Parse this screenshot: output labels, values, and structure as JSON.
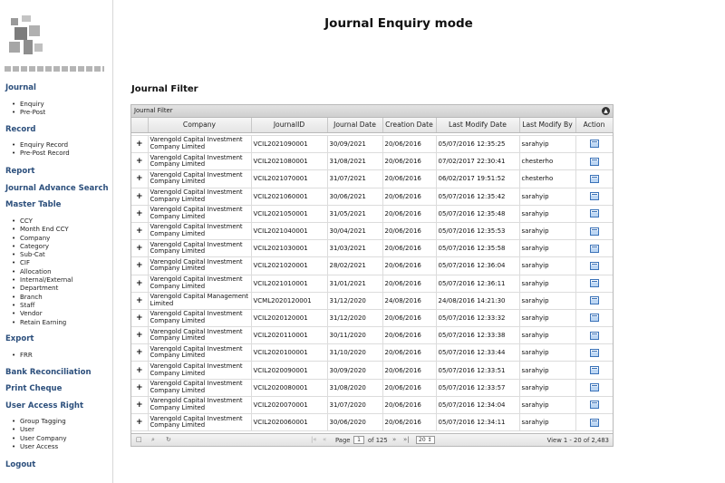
{
  "header": {
    "title": "Journal Enquiry mode"
  },
  "sidebar": {
    "journal": {
      "label": "Journal",
      "items": [
        "Enquiry",
        "Pre-Post"
      ]
    },
    "record": {
      "label": "Record",
      "items": [
        "Enquiry Record",
        "Pre-Post Record"
      ]
    },
    "report": {
      "label": "Report"
    },
    "journal_advance_search": {
      "label": "Journal Advance Search"
    },
    "master_table": {
      "label": "Master Table",
      "items": [
        "CCY",
        "Month End CCY",
        "Company",
        "Category",
        "Sub-Cat",
        "CIF",
        "Allocation",
        "Internal/External",
        "Department",
        "Branch",
        "Staff",
        "Vendor",
        "Retain Earning"
      ]
    },
    "export": {
      "label": "Export",
      "items": [
        "FRR"
      ]
    },
    "bank_reconciliation": {
      "label": "Bank Reconciliation"
    },
    "print_cheque": {
      "label": "Print Cheque"
    },
    "user_access_right": {
      "label": "User Access Right",
      "items": [
        "Group Tagging",
        "User",
        "User Company",
        "User Access"
      ]
    },
    "logout": {
      "label": "Logout"
    }
  },
  "main": {
    "section_heading": "Journal Filter",
    "grid": {
      "caption": "Journal Filter",
      "columns": [
        "Company",
        "JournalID",
        "Journal Date",
        "Creation Date",
        "Last Modify Date",
        "Last Modify By",
        "Action"
      ],
      "rows": [
        {
          "expand": "+",
          "company": "Varengold Capital Investment Company Limited",
          "journal_id": "VCIL2021090001",
          "journal_date": "30/09/2021",
          "creation_date": "20/06/2016",
          "last_modify_date": "05/07/2016 12:35:25",
          "last_modify_by": "sarahyip"
        },
        {
          "expand": "+",
          "company": "Varengold Capital Investment Company Limited",
          "journal_id": "VCIL2021080001",
          "journal_date": "31/08/2021",
          "creation_date": "20/06/2016",
          "last_modify_date": "07/02/2017 22:30:41",
          "last_modify_by": "chesterho"
        },
        {
          "expand": "+",
          "company": "Varengold Capital Investment Company Limited",
          "journal_id": "VCIL2021070001",
          "journal_date": "31/07/2021",
          "creation_date": "20/06/2016",
          "last_modify_date": "06/02/2017 19:51:52",
          "last_modify_by": "chesterho"
        },
        {
          "expand": "+",
          "company": "Varengold Capital Investment Company Limited",
          "journal_id": "VCIL2021060001",
          "journal_date": "30/06/2021",
          "creation_date": "20/06/2016",
          "last_modify_date": "05/07/2016 12:35:42",
          "last_modify_by": "sarahyip"
        },
        {
          "expand": "+",
          "company": "Varengold Capital Investment Company Limited",
          "journal_id": "VCIL2021050001",
          "journal_date": "31/05/2021",
          "creation_date": "20/06/2016",
          "last_modify_date": "05/07/2016 12:35:48",
          "last_modify_by": "sarahyip"
        },
        {
          "expand": "+",
          "company": "Varengold Capital Investment Company Limited",
          "journal_id": "VCIL2021040001",
          "journal_date": "30/04/2021",
          "creation_date": "20/06/2016",
          "last_modify_date": "05/07/2016 12:35:53",
          "last_modify_by": "sarahyip"
        },
        {
          "expand": "+",
          "company": "Varengold Capital Investment Company Limited",
          "journal_id": "VCIL2021030001",
          "journal_date": "31/03/2021",
          "creation_date": "20/06/2016",
          "last_modify_date": "05/07/2016 12:35:58",
          "last_modify_by": "sarahyip"
        },
        {
          "expand": "+",
          "company": "Varengold Capital Investment Company Limited",
          "journal_id": "VCIL2021020001",
          "journal_date": "28/02/2021",
          "creation_date": "20/06/2016",
          "last_modify_date": "05/07/2016 12:36:04",
          "last_modify_by": "sarahyip"
        },
        {
          "expand": "+",
          "company": "Varengold Capital Investment Company Limited",
          "journal_id": "VCIL2021010001",
          "journal_date": "31/01/2021",
          "creation_date": "20/06/2016",
          "last_modify_date": "05/07/2016 12:36:11",
          "last_modify_by": "sarahyip"
        },
        {
          "expand": "+",
          "company": "Varengold Capital Management Limited",
          "journal_id": "VCML2020120001",
          "journal_date": "31/12/2020",
          "creation_date": "24/08/2016",
          "last_modify_date": "24/08/2016 14:21:30",
          "last_modify_by": "sarahyip"
        },
        {
          "expand": "+",
          "company": "Varengold Capital Investment Company Limited",
          "journal_id": "VCIL2020120001",
          "journal_date": "31/12/2020",
          "creation_date": "20/06/2016",
          "last_modify_date": "05/07/2016 12:33:32",
          "last_modify_by": "sarahyip"
        },
        {
          "expand": "+",
          "company": "Varengold Capital Investment Company Limited",
          "journal_id": "VCIL2020110001",
          "journal_date": "30/11/2020",
          "creation_date": "20/06/2016",
          "last_modify_date": "05/07/2016 12:33:38",
          "last_modify_by": "sarahyip"
        },
        {
          "expand": "+",
          "company": "Varengold Capital Investment Company Limited",
          "journal_id": "VCIL2020100001",
          "journal_date": "31/10/2020",
          "creation_date": "20/06/2016",
          "last_modify_date": "05/07/2016 12:33:44",
          "last_modify_by": "sarahyip"
        },
        {
          "expand": "+",
          "company": "Varengold Capital Investment Company Limited",
          "journal_id": "VCIL2020090001",
          "journal_date": "30/09/2020",
          "creation_date": "20/06/2016",
          "last_modify_date": "05/07/2016 12:33:51",
          "last_modify_by": "sarahyip"
        },
        {
          "expand": "+",
          "company": "Varengold Capital Investment Company Limited",
          "journal_id": "VCIL2020080001",
          "journal_date": "31/08/2020",
          "creation_date": "20/06/2016",
          "last_modify_date": "05/07/2016 12:33:57",
          "last_modify_by": "sarahyip"
        },
        {
          "expand": "+",
          "company": "Varengold Capital Investment Company Limited",
          "journal_id": "VCIL2020070001",
          "journal_date": "31/07/2020",
          "creation_date": "20/06/2016",
          "last_modify_date": "05/07/2016 12:34:04",
          "last_modify_by": "sarahyip"
        },
        {
          "expand": "+",
          "company": "Varengold Capital Investment Company Limited",
          "journal_id": "VCIL2020060001",
          "journal_date": "30/06/2020",
          "creation_date": "20/06/2016",
          "last_modify_date": "05/07/2016 12:34:11",
          "last_modify_by": "sarahyip"
        }
      ],
      "pager": {
        "page_label": "Page",
        "current_page": "1",
        "of_label": "of 125",
        "rows_per_page": "20",
        "record_info": "View 1 - 20 of 2,483",
        "icons": [
          "add-icon",
          "search-icon",
          "refresh-icon",
          "first-page-icon",
          "prev-page-icon",
          "next-page-icon",
          "last-page-icon",
          "collapse-icon",
          "edit-icon"
        ]
      }
    }
  },
  "colors": {
    "nav_link": "#2c4f7c",
    "edit_icon": "#3a72b8"
  }
}
